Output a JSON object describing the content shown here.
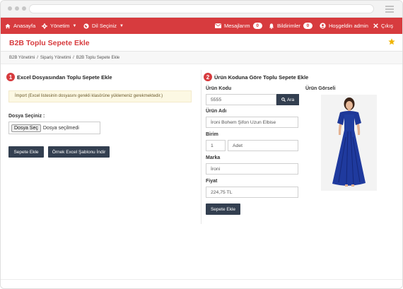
{
  "nav": {
    "home": "Anasayfa",
    "management": "Yönetim",
    "language": "Dil Seçiniz",
    "messages": "Mesajlarım",
    "messages_count": "0",
    "notifications": "Bildirimler",
    "notifications_count": "0",
    "welcome": "Hoşgeldin admin",
    "logout": "Çıkış"
  },
  "page": {
    "title": "B2B Toplu Sepete Ekle",
    "star_color": "#f0b400"
  },
  "breadcrumb": [
    "B2B Yönetimi",
    "Sipariş Yönetimi",
    "B2B Toplu Sepete Ekle"
  ],
  "left": {
    "step": "1",
    "title": "Excel Dosyasından Toplu Sepete Ekle",
    "notice": "İmport (Excel listesinin dosyasını gerekli klasörüne yüklemeniz gerekmektedir.)",
    "file_label": "Dosya Seçiniz :",
    "file_button": "Dosya Seç",
    "file_status": "Dosya seçilmedi",
    "add_button": "Sepete Ekle",
    "template_button": "Örnek Excel Şablonu İndir"
  },
  "right": {
    "step": "2",
    "title": "Ürün Koduna Göre Toplu Sepete Ekle",
    "code_label": "Ürün Kodu",
    "code_value": "5555",
    "search_button": "Ara",
    "name_label": "Ürün Adı",
    "name_value": "İroni Bohem Şifon Uzun Elbise",
    "unit_label": "Birim",
    "qty_value": "1",
    "unit_value": "Adet",
    "brand_label": "Marka",
    "brand_value": "İroni",
    "price_label": "Fiyat",
    "price_value": "224,75 TL",
    "add_button": "Sepete Ekle",
    "image_label": "Ürün Görseli"
  },
  "colors": {
    "brand_red": "#d73b3e",
    "dark_button": "#333f50",
    "dress_blue": "#1f3a9e"
  }
}
